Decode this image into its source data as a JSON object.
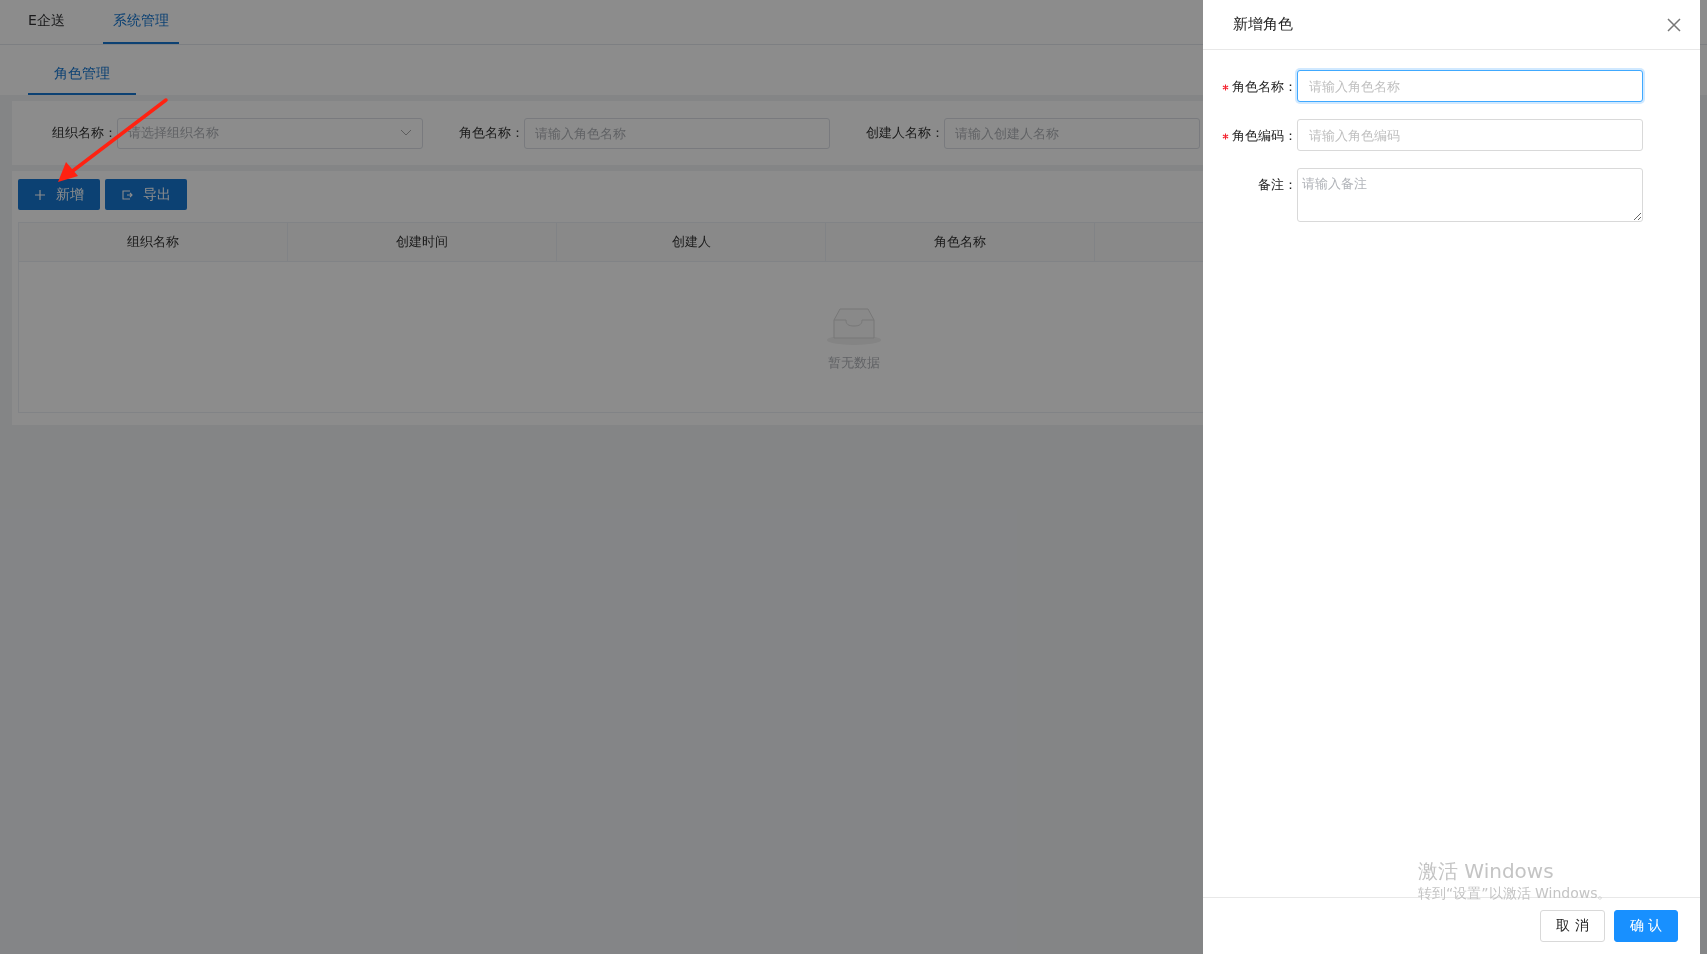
{
  "top_tabs": [
    {
      "label": "E企送",
      "selected": false
    },
    {
      "label": "系统管理",
      "selected": true
    }
  ],
  "sub_tabs": [
    {
      "label": "角色管理",
      "selected": true
    }
  ],
  "filters": [
    {
      "label": "组织名称：",
      "placeholder": "请选择组织名称",
      "kind": "select"
    },
    {
      "label": "角色名称：",
      "placeholder": "请输入角色名称",
      "kind": "input"
    },
    {
      "label": "创建人名称：",
      "placeholder": "请输入创建人名称",
      "kind": "input"
    }
  ],
  "toolbar": [
    {
      "label": "新增",
      "kind": "add"
    },
    {
      "label": "导出",
      "kind": "export"
    }
  ],
  "table": {
    "columns": [
      "组织名称",
      "创建时间",
      "创建人",
      "角色名称"
    ],
    "empty_text": "暂无数据"
  },
  "drawer": {
    "title": "新增角色",
    "fields": [
      {
        "label": "角色名称：",
        "placeholder": "请输入角色名称",
        "required": true,
        "focused": true,
        "kind": "input"
      },
      {
        "label": "角色编码：",
        "placeholder": "请输入角色编码",
        "required": true,
        "focused": false,
        "kind": "input"
      },
      {
        "label": "备注：",
        "placeholder": "请输入备注",
        "required": false,
        "focused": false,
        "kind": "textarea"
      }
    ],
    "buttons": [
      {
        "label": "取 消",
        "kind": "default"
      },
      {
        "label": "确 认",
        "kind": "primary"
      }
    ]
  },
  "os_watermark": {
    "title": "激活 Windows",
    "subtitle": "转到“设置”以激活 Windows。"
  }
}
